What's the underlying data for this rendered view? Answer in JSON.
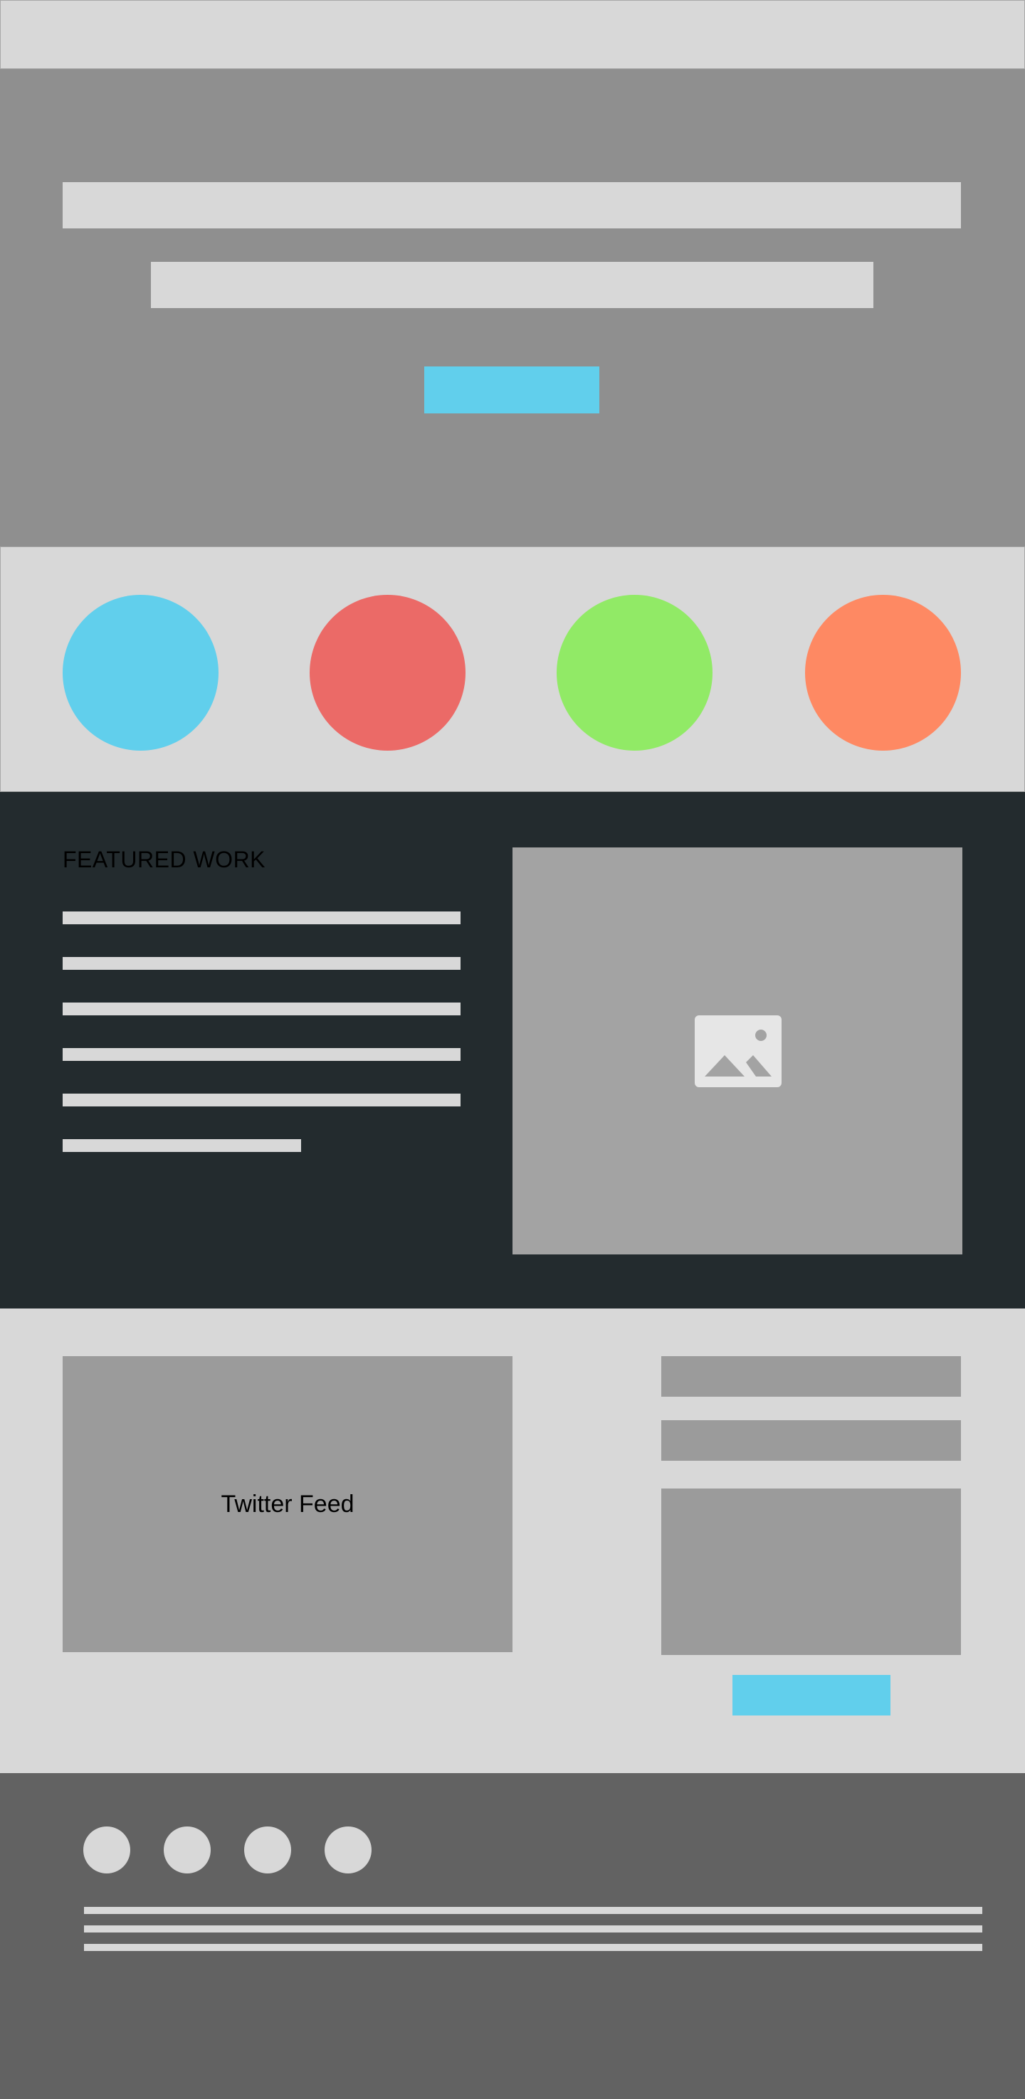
{
  "hero": {
    "cta_color": "#61cfec"
  },
  "features": {
    "circles": [
      {
        "name": "feature-circle-blue",
        "color": "#61cfec"
      },
      {
        "name": "feature-circle-red",
        "color": "#eb6a67"
      },
      {
        "name": "feature-circle-green",
        "color": "#91ea66"
      },
      {
        "name": "feature-circle-orange",
        "color": "#fe8963"
      }
    ]
  },
  "work": {
    "title": "FEATURED WORK",
    "image_icon": "image-icon"
  },
  "social": {
    "twitter_label": "Twitter Feed",
    "submit_color": "#61cfec"
  },
  "footer": {
    "social_icons": [
      "social-icon-1",
      "social-icon-2",
      "social-icon-3",
      "social-icon-4"
    ]
  },
  "colors": {
    "wireframe_light": "#d8d8d8",
    "wireframe_mid": "#8f8f8f",
    "wireframe_dark": "#232b2e",
    "footer": "#626262",
    "accent": "#61cfec"
  }
}
